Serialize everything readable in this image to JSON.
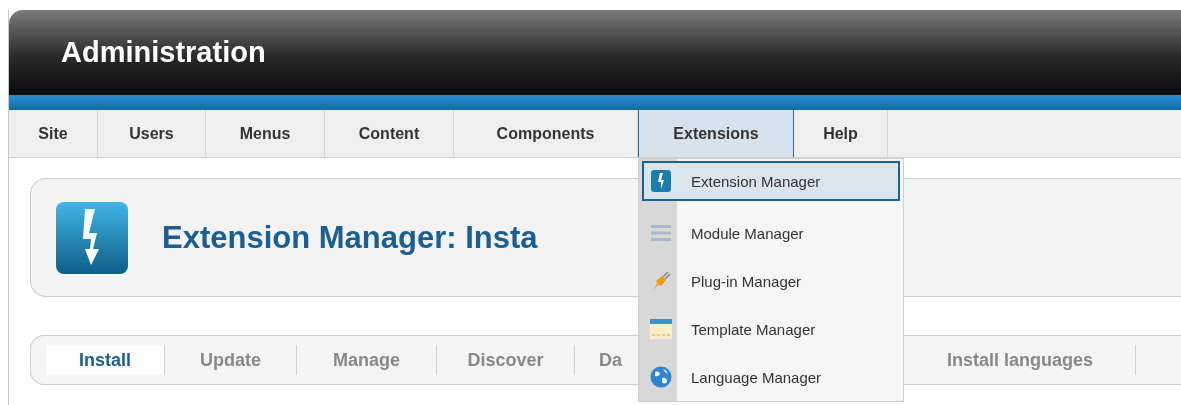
{
  "header": {
    "title": "Administration"
  },
  "menu": [
    {
      "label": "Site",
      "selected": false
    },
    {
      "label": "Users",
      "selected": false
    },
    {
      "label": "Menus",
      "selected": false
    },
    {
      "label": "Content",
      "selected": false
    },
    {
      "label": "Components",
      "selected": false
    },
    {
      "label": "Extensions",
      "selected": true
    },
    {
      "label": "Help",
      "selected": false
    }
  ],
  "dropdown": [
    {
      "label": "Extension Manager",
      "kind": "bolt",
      "selected": true
    },
    {
      "label": "Module Manager",
      "kind": "lines",
      "selected": false
    },
    {
      "label": "Plug-in Manager",
      "kind": "plug",
      "selected": false
    },
    {
      "label": "Template Manager",
      "kind": "window",
      "selected": false
    },
    {
      "label": "Language Manager",
      "kind": "globe",
      "selected": false
    }
  ],
  "page_title": "Extension Manager: Insta",
  "subtabs": [
    {
      "label": "Install",
      "selected": true
    },
    {
      "label": "Update",
      "selected": false
    },
    {
      "label": "Manage",
      "selected": false
    },
    {
      "label": "Discover",
      "selected": false
    },
    {
      "label": "Da",
      "selected": false
    },
    {
      "label": "Install languages",
      "selected": false
    }
  ]
}
